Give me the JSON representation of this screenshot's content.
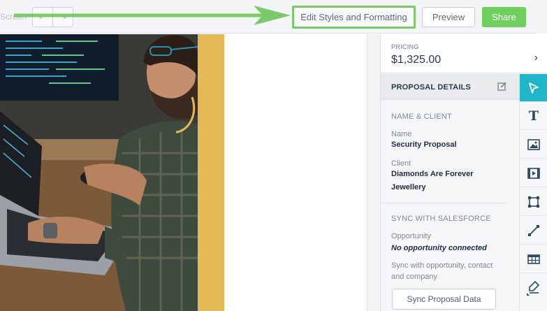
{
  "toolbar": {
    "screen_label": "Screen",
    "edit_styles_label": "Edit Styles and Formatting",
    "preview_label": "Preview",
    "share_label": "Share"
  },
  "pricing": {
    "label": "PRICING",
    "value": "$1,325.00"
  },
  "details": {
    "title": "PROPOSAL DETAILS",
    "name_client": {
      "section_title": "NAME & CLIENT",
      "name_label": "Name",
      "name_value": "Security Proposal",
      "client_label": "Client",
      "client_value": "Diamonds Are Forever Jewellery"
    },
    "salesforce": {
      "section_title": "SYNC WITH SALESFORCE",
      "opportunity_label": "Opportunity",
      "opportunity_value": "No opportunity connected",
      "description": "Sync with opportunity, contact and company",
      "sync_button": "Sync Proposal Data"
    }
  },
  "tools": [
    "pointer-icon",
    "text-icon",
    "image-icon",
    "video-icon",
    "shape-icon",
    "line-icon",
    "table-icon",
    "signature-icon"
  ],
  "colors": {
    "accent": "#1fb6c9",
    "share": "#6fcf5f",
    "highlight": "#7cc96a",
    "gold_block": "#e5b955"
  }
}
